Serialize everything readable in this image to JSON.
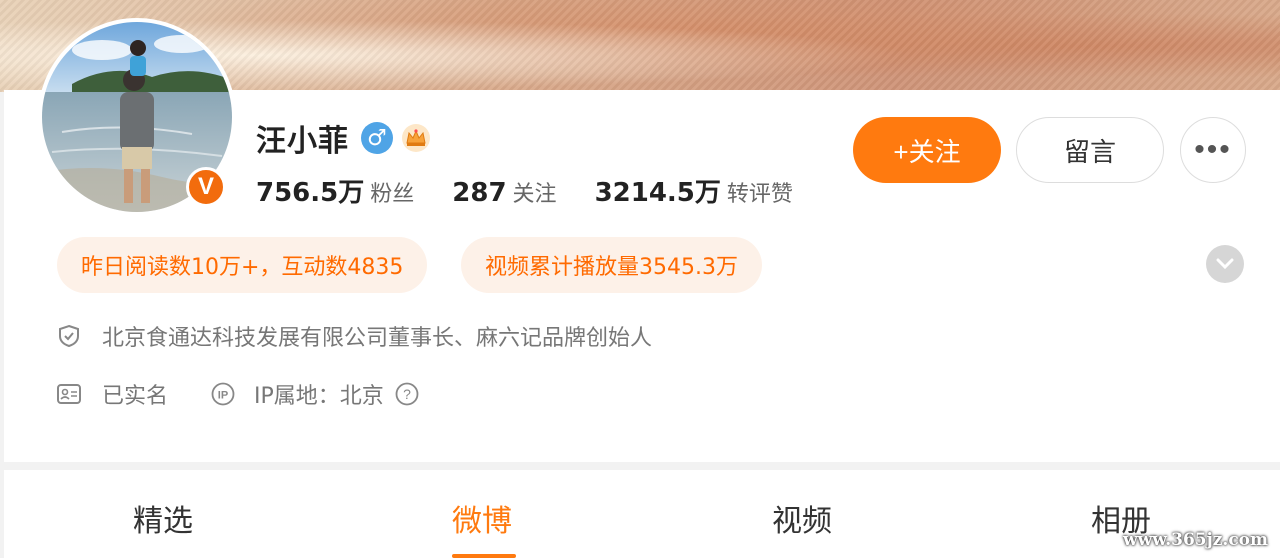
{
  "profile": {
    "name": "汪小菲",
    "gender_symbol": "♂",
    "verified_symbol": "V"
  },
  "stats": [
    {
      "value": "756.5万",
      "label": "粉丝"
    },
    {
      "value": "287",
      "label": "关注"
    },
    {
      "value": "3214.5万",
      "label": "转评赞"
    }
  ],
  "actions": {
    "follow_label": "+关注",
    "message_label": "留言",
    "more_label": "•••"
  },
  "highlights": {
    "reads": "昨日阅读数10万+，互动数4835",
    "video": "视频累计播放量3545.3万"
  },
  "info": {
    "title": "北京食通达科技发展有限公司董事长、麻六记品牌创始人",
    "verified": "已实名",
    "ip": "IP属地：北京"
  },
  "tabs": [
    {
      "label": "精选"
    },
    {
      "label": "微博"
    },
    {
      "label": "视频"
    },
    {
      "label": "相册"
    }
  ],
  "active_tab": "微博",
  "watermark": "www.365jz.com",
  "colors": {
    "accent": "#ff7a0f",
    "pill_bg": "#fdf1e8",
    "gender_blue": "#4fa4e6",
    "verified_orange": "#f26c0d"
  }
}
